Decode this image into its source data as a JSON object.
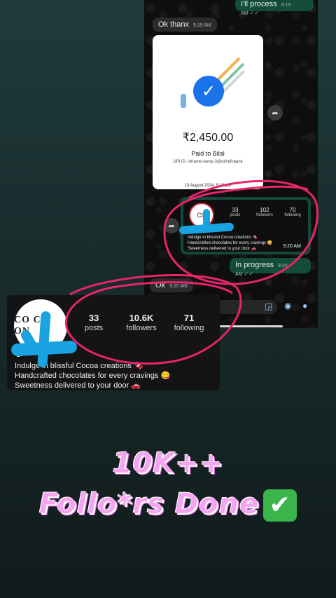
{
  "chat": {
    "messages": [
      {
        "text": "I'll process",
        "time": "9:19 AM",
        "direction": "out"
      },
      {
        "text": "Ok thanx",
        "time": "9:19 AM",
        "direction": "in"
      },
      {
        "text": "In progress",
        "time": "9:20 AM",
        "direction": "out"
      },
      {
        "text": "Ok",
        "time": "9:20 AM",
        "direction": "in"
      }
    ],
    "payment": {
      "amount": "₹2,450.00",
      "paid_to": "Paid to Bilal",
      "upi": "UPI ID: inframe.vamp-3@okhdfcbank",
      "date": "13 August 2024, 9:19 am"
    },
    "shared_profile": {
      "posts": "33",
      "posts_label": "posts",
      "followers": "102",
      "followers_label": "followers",
      "following": "70",
      "following_label": "following",
      "bio1": "Indulge in blissful Cocoa creations 🍫",
      "bio2": "Handcrafted chocolates for every cravings 😋",
      "bio3": "Sweetness delivered to your door 🚗",
      "time": "9:20 AM"
    }
  },
  "profile_card": {
    "avatar_text": "CO CO ON",
    "posts": "33",
    "posts_label": "posts",
    "followers": "10.6K",
    "followers_label": "followers",
    "following": "71",
    "following_label": "following",
    "name": "C",
    "bio1": "Indulge in blissful Cocoa creations 🍫",
    "bio2": "Handcrafted chocolates for every cravings 😋",
    "bio3": "Sweetness delivered to your door 🚗"
  },
  "headline": {
    "line1": "10K++",
    "line2": "Follo*rs Done",
    "check": "✔"
  },
  "icons": [
    "forward-icon",
    "sticker-icon",
    "camera-icon",
    "mic-icon",
    "check-icon"
  ],
  "colors": {
    "accent_pink": "#f4a6f0",
    "scribble_blue": "#19a3e0",
    "annotation_pink": "#e8246c",
    "bubble_green": "#144d37"
  }
}
